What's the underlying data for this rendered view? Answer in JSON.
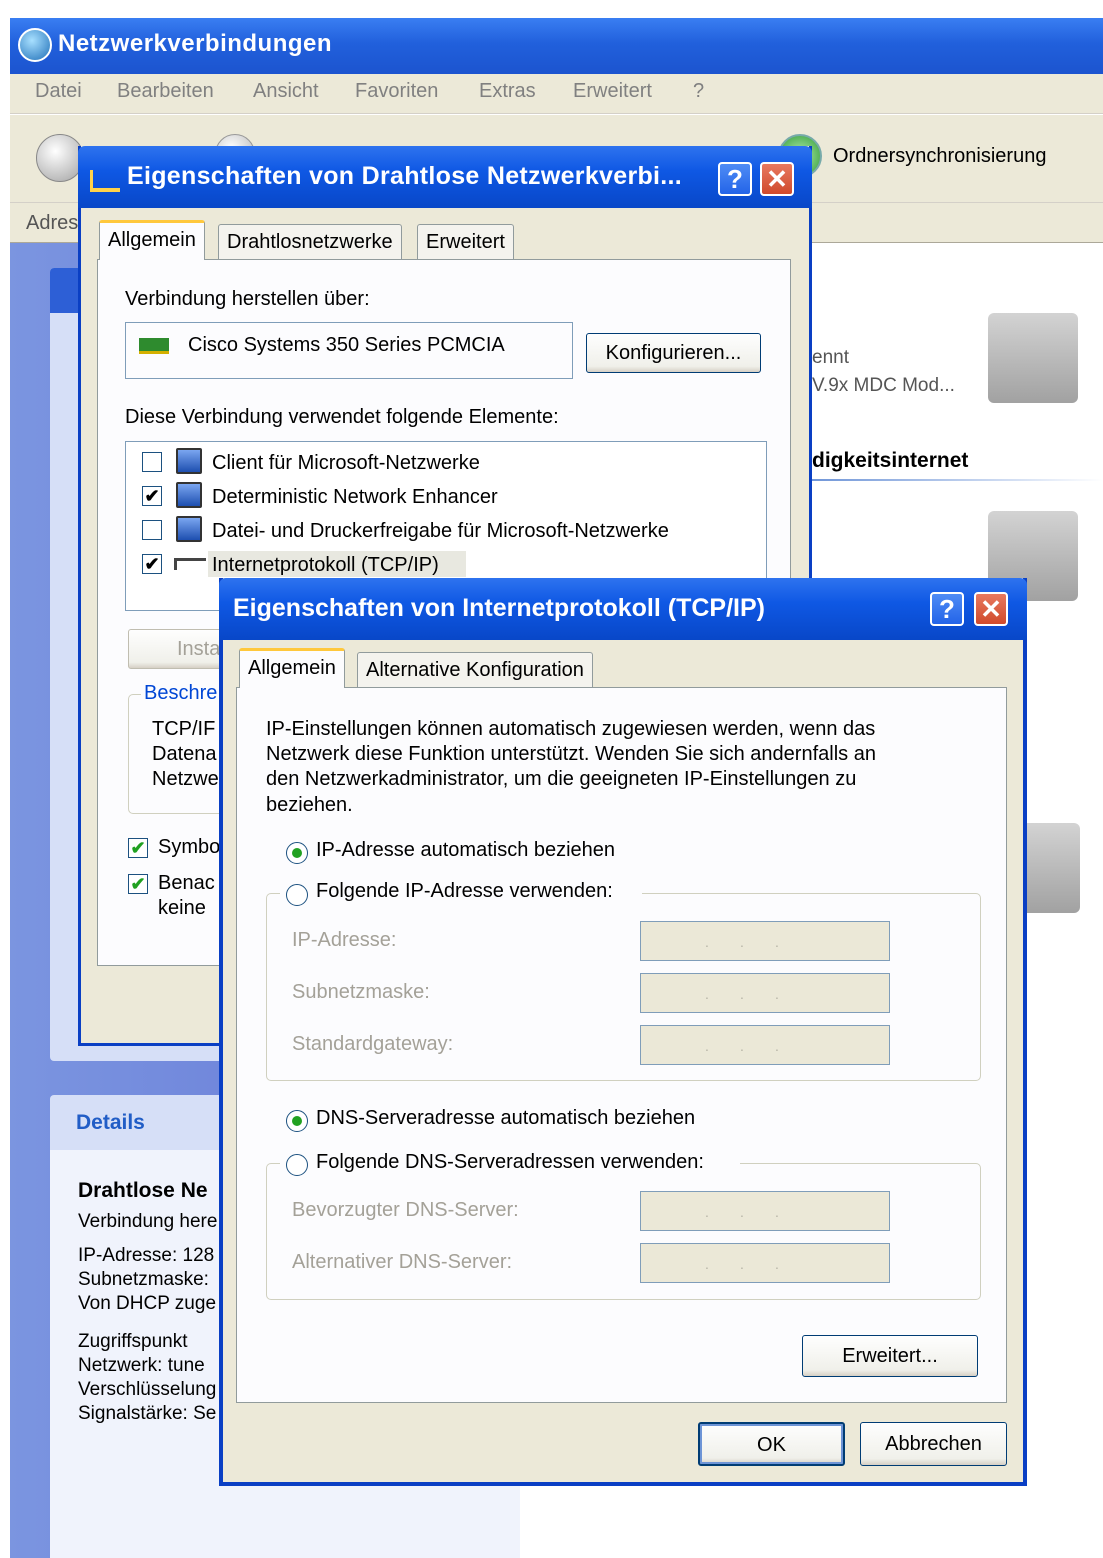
{
  "main_window": {
    "title": "Netzwerkverbindungen",
    "menu": [
      "Datei",
      "Bearbeiten",
      "Ansicht",
      "Favoriten",
      "Extras",
      "Erweitert",
      "?"
    ],
    "toolbar_sync_label": "Ordnersynchronisierung",
    "address_label": "Adres",
    "right_pane": {
      "item1_line1": "ennt",
      "item1_line2": "V.9x MDC Mod...",
      "section_heading": "digkeitsinternet"
    },
    "details": {
      "heading": "Details",
      "name": "Drahtlose Ne",
      "lines": [
        "Verbindung here",
        "IP-Adresse: 128",
        "Subnetzmaske:",
        "Von DHCP zuge",
        "Zugriffspunkt",
        "Netzwerk: tune",
        "Verschlüsselung",
        "Signalstärke: Se"
      ]
    }
  },
  "dialog_wireless": {
    "title": "Eigenschaften von Drahtlose Netzwerkverbi...",
    "tabs": [
      "Allgemein",
      "Drahtlosnetzwerke",
      "Erweitert"
    ],
    "connect_using_label": "Verbindung herstellen über:",
    "adapter_name": "Cisco Systems 350 Series PCMCIA",
    "configure_button": "Konfigurieren...",
    "elements_label": "Diese Verbindung verwendet folgende Elemente:",
    "elements": [
      {
        "label": "Client für Microsoft-Netzwerke",
        "checked": false
      },
      {
        "label": "Deterministic Network Enhancer",
        "checked": true
      },
      {
        "label": "Datei- und Druckerfreigabe für Microsoft-Netzwerke",
        "checked": false
      },
      {
        "label": "Internetprotokoll (TCP/IP)",
        "checked": true
      }
    ],
    "install_button": "Insta",
    "description_group": "Beschre",
    "description_lines": [
      "TCP/IF",
      "Datena",
      "Netzwe"
    ],
    "show_icon_label": "Symbo",
    "notify_label_line1": "Benac",
    "notify_label_line2": "keine"
  },
  "dialog_tcpip": {
    "title": "Eigenschaften von Internetprotokoll (TCP/IP)",
    "tabs": [
      "Allgemein",
      "Alternative Konfiguration"
    ],
    "intro_lines": [
      "IP-Einstellungen können automatisch zugewiesen werden, wenn das",
      "Netzwerk diese Funktion unterstützt. Wenden Sie sich andernfalls an",
      "den Netzwerkadministrator, um die geeigneten IP-Einstellungen zu",
      "beziehen."
    ],
    "ip_auto_label": "IP-Adresse automatisch beziehen",
    "ip_manual_label": "Folgende IP-Adresse verwenden:",
    "ip_address_label": "IP-Adresse:",
    "subnet_label": "Subnetzmaske:",
    "gateway_label": "Standardgateway:",
    "dns_auto_label": "DNS-Serveradresse automatisch beziehen",
    "dns_manual_label": "Folgende DNS-Serveradressen verwenden:",
    "preferred_dns_label": "Bevorzugter DNS-Server:",
    "alternate_dns_label": "Alternativer DNS-Server:",
    "ip_field_dots": ".        .        .",
    "advanced_button": "Erweitert...",
    "ok_button": "OK",
    "cancel_button": "Abbrechen",
    "help_glyph": "?",
    "close_glyph": "✕"
  },
  "colors": {
    "title_blue": "#0f58e4",
    "dialog_bg": "#ece9d8",
    "radio_dot": "#21a121",
    "left_pane": "#6375d6"
  }
}
